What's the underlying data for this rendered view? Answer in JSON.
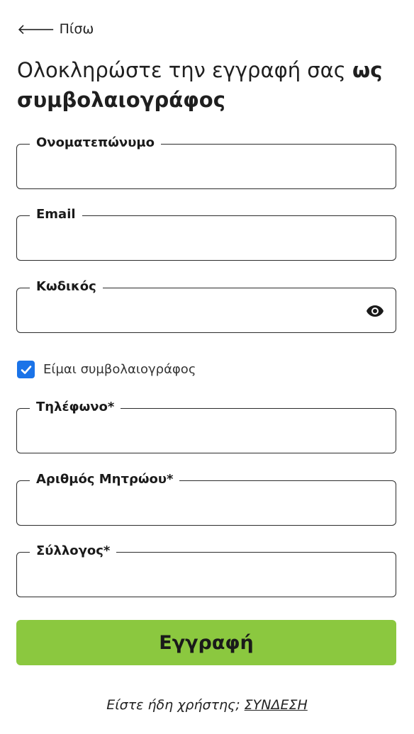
{
  "back": {
    "label": "Πίσω"
  },
  "title": {
    "regular": "Ολοκληρώστε την εγγραφή σας ",
    "bold": "ως συμβολαιογράφος"
  },
  "fields": {
    "fullname": {
      "label": "Ονοματεπώνυμο",
      "value": ""
    },
    "email": {
      "label": "Email",
      "value": ""
    },
    "password": {
      "label": "Κωδικός",
      "value": ""
    },
    "phone": {
      "label": "Τηλέφωνο*",
      "value": ""
    },
    "registry": {
      "label": "Αριθμός Μητρώου*",
      "value": ""
    },
    "association": {
      "label": "Σύλλογος*",
      "value": ""
    }
  },
  "notary_checkbox": {
    "label": "Είμαι συμβολαιογράφος",
    "checked": true
  },
  "submit": {
    "label": "Εγγραφή"
  },
  "footer": {
    "prompt": "Είστε ήδη χρήστης; ",
    "link": "ΣΥΝΔΕΣΗ"
  },
  "colors": {
    "accent": "#8bc83f",
    "checkbox": "#1a73e8"
  }
}
